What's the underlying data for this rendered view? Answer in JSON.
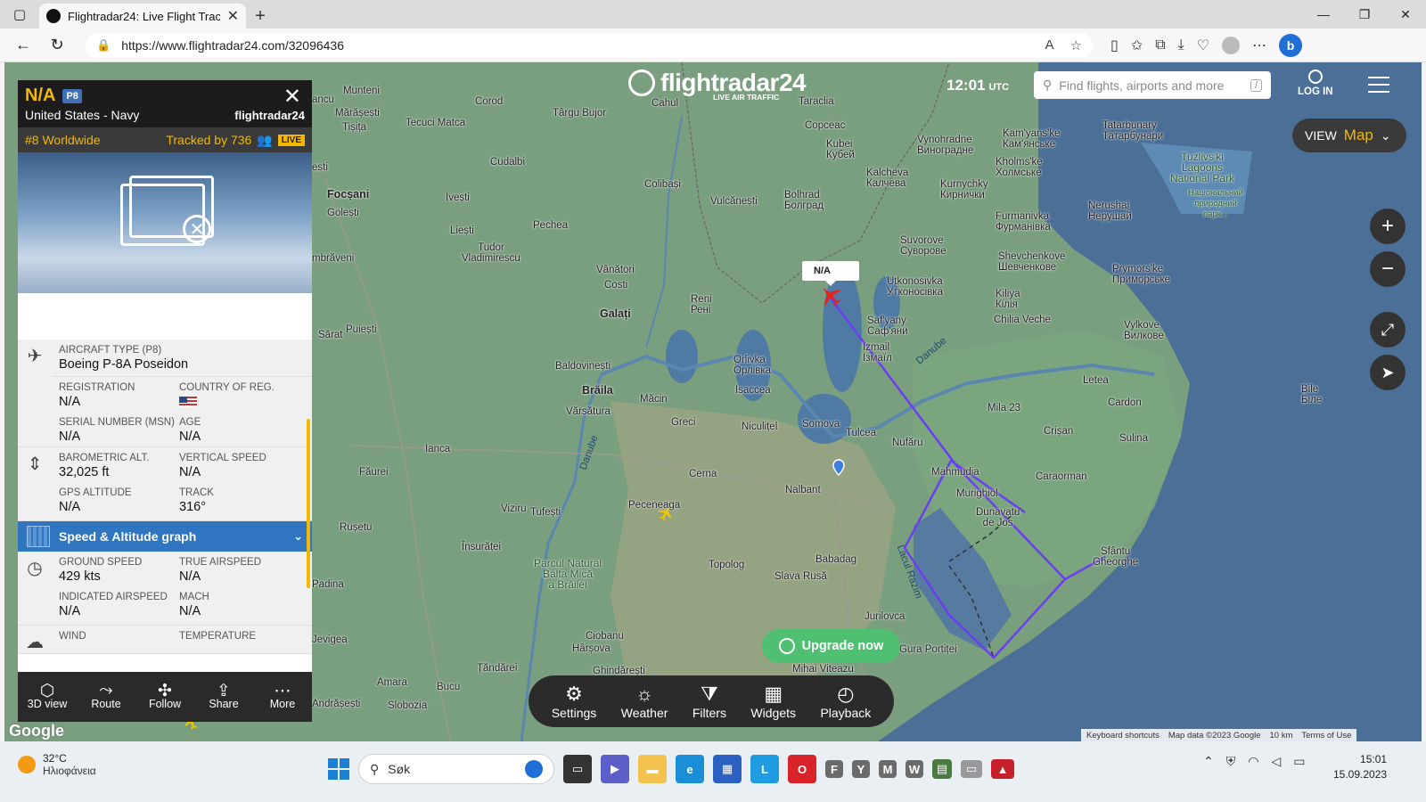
{
  "browser": {
    "tab_title": "Flightradar24: Live Flight Tracker",
    "url": "https://www.flightradar24.com/32096436"
  },
  "header": {
    "logo_text": "flightradar24",
    "logo_sub": "LIVE AIR TRAFFIC",
    "time": "12:01",
    "time_zone": "UTC",
    "search_placeholder": "Find flights, airports and more",
    "search_shortcut": "/",
    "login_label": "LOG IN",
    "view_label": "VIEW",
    "view_value": "Map"
  },
  "flight": {
    "callsign": "N/A",
    "type_badge": "P8",
    "operator": "United States - Navy",
    "brand": "flightradar24",
    "rank": "#8 Worldwide",
    "tracked": "Tracked by 736",
    "live": "LIVE",
    "aircraft_type_label": "AIRCRAFT TYPE (P8)",
    "aircraft_type": "Boeing P-8A Poseidon",
    "registration_label": "REGISTRATION",
    "registration": "N/A",
    "country_label": "COUNTRY OF REG.",
    "serial_label": "SERIAL NUMBER (MSN)",
    "serial": "N/A",
    "age_label": "AGE",
    "age": "N/A",
    "baro_alt_label": "BAROMETRIC ALT.",
    "baro_alt": "32,025 ft",
    "vert_speed_label": "VERTICAL SPEED",
    "vert_speed": "N/A",
    "gps_alt_label": "GPS ALTITUDE",
    "gps_alt": "N/A",
    "track_label": "TRACK",
    "track": "316°",
    "graph_label": "Speed & Altitude graph",
    "ground_speed_label": "GROUND SPEED",
    "ground_speed": "429 kts",
    "true_airspeed_label": "TRUE AIRSPEED",
    "true_airspeed": "N/A",
    "ias_label": "INDICATED AIRSPEED",
    "ias": "N/A",
    "mach_label": "MACH",
    "mach": "N/A",
    "wind_label": "WIND",
    "temp_label": "TEMPERATURE",
    "map_tag": "N/A"
  },
  "panel_footer": [
    "3D view",
    "Route",
    "Follow",
    "Share",
    "More"
  ],
  "tools": [
    "Settings",
    "Weather",
    "Filters",
    "Widgets",
    "Playback"
  ],
  "upgrade": "Upgrade now",
  "attribution": [
    "Keyboard shortcuts",
    "Map data ©2023 Google",
    "10 km",
    "Terms of Use"
  ],
  "google": "Google",
  "places": {
    "munteni": "Munteni",
    "cahul": "Cahul",
    "taraclia": "Taraclia",
    "corod": "Corod",
    "tirgu": "Târgu Bujor",
    "marasesti": "Mărășești",
    "tisita": "Tișița",
    "matca": "Tecuci Matca",
    "copceac": "Copceac",
    "kubei": "Kubei\nКубей",
    "vynohradne": "Vynohradne\nВиноградне",
    "kamyanske": "Kam'yans'ke\nКам'янське",
    "tatarbunary": "Tatarbunary\nТатарбунари",
    "cudalbi": "Cudalbi",
    "colibasi": "Colibași",
    "vulcanesti": "Vulcănești",
    "bolhrad": "Bolhrad\nБолград",
    "kalcheva": "Kalcheva\nКалчева",
    "kholmske": "Kholms'ke\nХолмське",
    "kurnychky": "Kurnychky\nКирнички",
    "focsani": "Focșani",
    "golesti": "Golești",
    "ivesti": "Ivești",
    "liesti": "Liești",
    "furmanivka": "Furmanivka\nФурманівка",
    "nerushai": "Nerushai\nНерушай",
    "tuzly": "Tuzlivs'ki\nLagoons\nNational Park",
    "tuzly2": "Національний\nприродний\nпарк...",
    "pechea": "Pechea",
    "tudor": "Tudor\nVladimirescu",
    "suvorove": "Suvorove\nСуворове",
    "shevchenkove": "Shevchenkove\nШевченкове",
    "primorske": "Prymors'ke\nПриморське",
    "vanatori": "Vânători",
    "costi": "Costi",
    "reni": "Reni\nРені",
    "utkonosivka": "Utkonosivka\nУтконосівка",
    "kiliya": "Kiliya\nКілія",
    "chilia": "Chilia Veche",
    "galati": "Galați",
    "safyany": "Saf'yany\nСаф'яни",
    "vylkove": "Vylkove\nВилкове",
    "puiesti": "Puiești",
    "sarat": "Sărat",
    "izmail": "Izmail\nІзмаїл",
    "orlivka": "Orlivka\nОрлівка",
    "baldovinesti": "Baldovinești",
    "braila": "Brăila",
    "isaccea": "Isaccea",
    "letea": "Letea",
    "bile": "Bile\nБіле",
    "varsatura": "Vărsătura",
    "macin": "Măcin",
    "mila23": "Mila 23",
    "cardon": "Cardon",
    "greci": "Greci",
    "niculitel": "Niculițel",
    "somova": "Somova",
    "tulcea": "Tulcea",
    "crisan": "Crișan",
    "sulina": "Sulina",
    "nufaru": "Nufăru",
    "ianca": "Ianca",
    "faurei": "Făurei",
    "mahmudia": "Mahmudia",
    "cerna": "Cerna",
    "nalbant": "Nalbant",
    "murighiol": "Murighiol",
    "caraorman": "Caraorman",
    "dunavatu": "Dunavatu\nde Jos",
    "pecineaga": "Peceneaga",
    "viziru": "Viziru",
    "tufesti": "Tufești",
    "rusetu": "Rușetu",
    "insuratei": "Însurăței",
    "parcul": "Parcul Natural\nBalta Mică\na Brăilei",
    "sfantu": "Sfântu\nGheorghe",
    "topolog": "Topolog",
    "babadag": "Babadag",
    "slava": "Slava Rusă",
    "jurilovca": "Jurilovca",
    "padina": "Padina",
    "ciobanu": "Ciobanu",
    "harsova": "Hârșova",
    "gura": "Gura Portiței",
    "ghindaresti": "Ghindărești",
    "mihai": "Mihai Viteazu",
    "amara": "Amara",
    "bucu": "Bucu",
    "slobozia": "Slobozia",
    "tandarei": "Țăndărei",
    "sevigae": "Jevigea",
    "andrasesti": "Andrășești",
    "lacul": "Lacul Razim",
    "danube": "Danube",
    "danube2": "Danube",
    "bravi": "mbrăveni",
    "esti": "esti",
    "ancu": "ancu"
  },
  "taskbar": {
    "temp": "32°C",
    "cond": "Ηλιοφάνεια",
    "search": "Søk",
    "time": "15:01",
    "date": "15.09.2023"
  }
}
